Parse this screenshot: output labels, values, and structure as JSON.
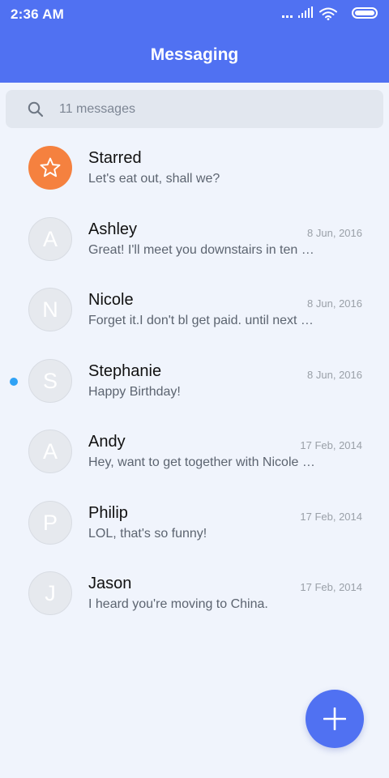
{
  "status": {
    "time": "2:36 AM"
  },
  "header": {
    "title": "Messaging"
  },
  "search": {
    "placeholder": "11 messages"
  },
  "conversations": [
    {
      "avatar_letter": "",
      "icon": "star-icon",
      "name": "Starred",
      "date": "",
      "preview": "Let's eat out, shall we?",
      "unread": false
    },
    {
      "avatar_letter": "A",
      "name": "Ashley",
      "date": "8 Jun, 2016",
      "preview": "Great! I'll meet you downstairs in ten minutes.",
      "unread": false
    },
    {
      "avatar_letter": "N",
      "name": "Nicole",
      "date": "8 Jun, 2016",
      "preview": "Forget it.I don't bl get paid. until next Friday.",
      "unread": false
    },
    {
      "avatar_letter": "S",
      "name": "Stephanie",
      "date": "8 Jun, 2016",
      "preview": "Happy Birthday!",
      "unread": true
    },
    {
      "avatar_letter": "A",
      "name": "Andy",
      "date": "17 Feb, 2014",
      "preview": "Hey, want to get together with Nicole and the others?",
      "unread": false
    },
    {
      "avatar_letter": "P",
      "name": "Philip",
      "date": "17 Feb, 2014",
      "preview": "LOL, that's so funny!",
      "unread": false
    },
    {
      "avatar_letter": "J",
      "name": "Jason",
      "date": "17 Feb, 2014",
      "preview": "I heard you're moving to China.",
      "unread": false
    }
  ],
  "colors": {
    "header_bg": "#5071f2",
    "starred_avatar": "#f5813f",
    "unread_dot": "#2fa2f5",
    "background": "#f0f4fc"
  },
  "fab": {
    "icon": "plus-icon"
  }
}
